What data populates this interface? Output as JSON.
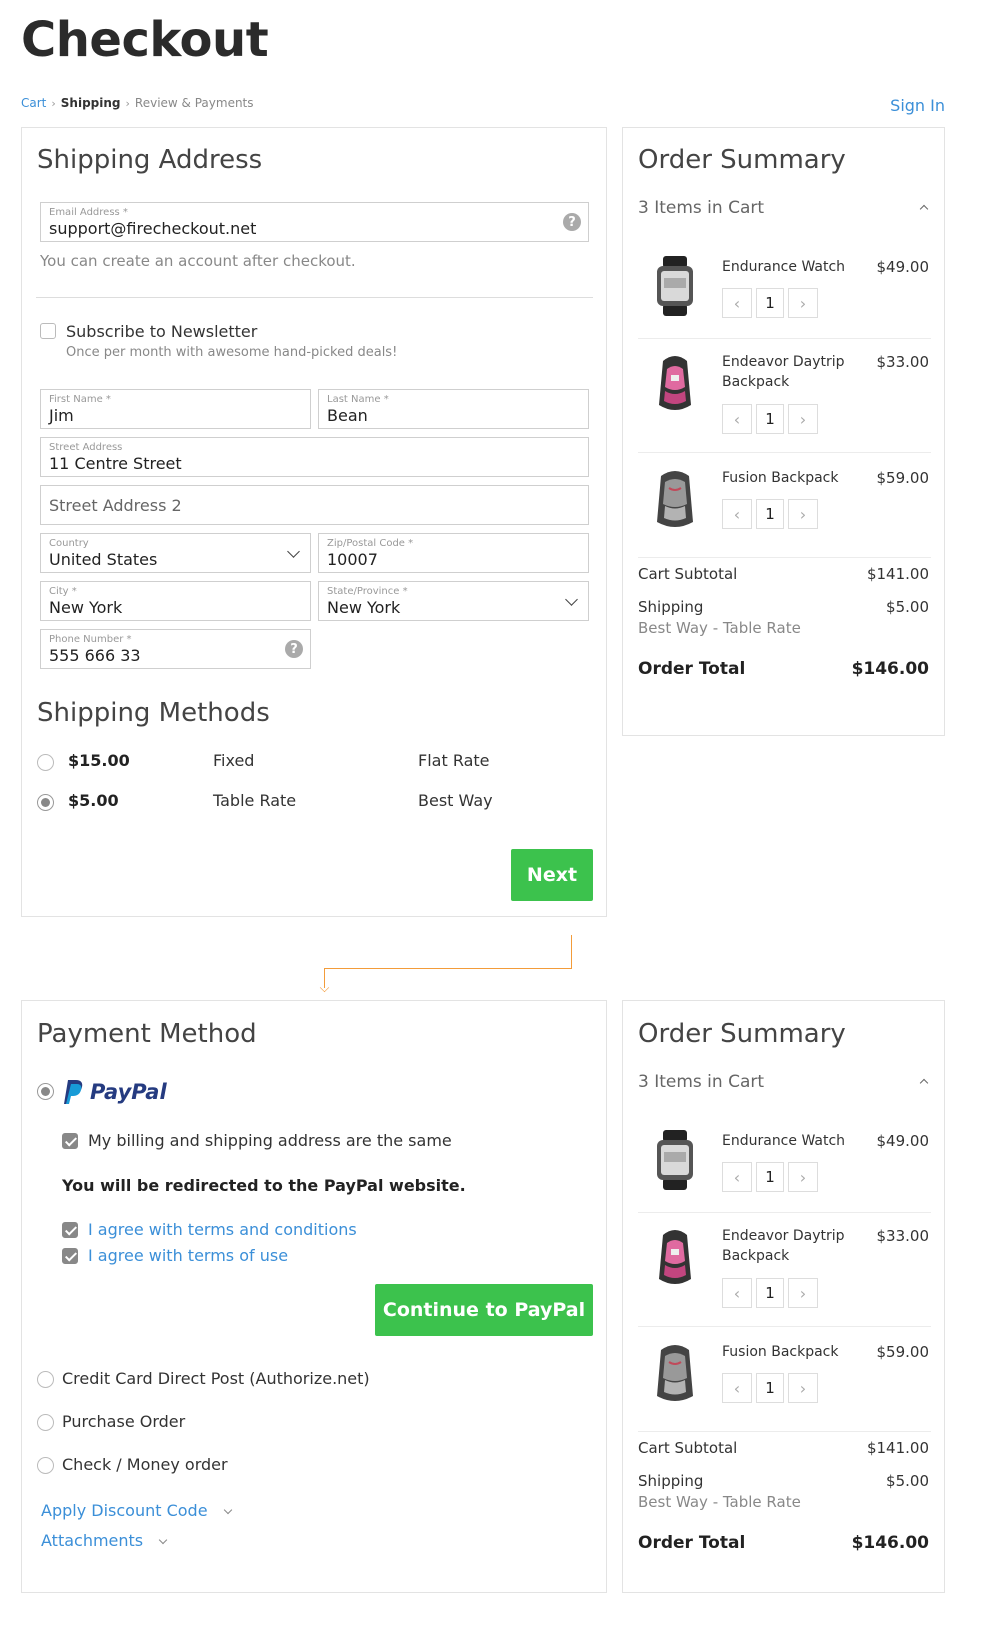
{
  "page": {
    "title": "Checkout",
    "sign_in": "Sign In"
  },
  "breadcrumb": [
    {
      "label": "Cart"
    },
    {
      "label": "Shipping"
    },
    {
      "label": "Review & Payments"
    }
  ],
  "shipping": {
    "title": "Shipping Address",
    "email": {
      "label": "Email Address *",
      "value": "support@firecheckout.net",
      "note": "You can create an account after checkout."
    },
    "newsletter": {
      "label": "Subscribe to Newsletter",
      "sub": "Once per month with awesome hand-picked deals!"
    },
    "first_name": {
      "label": "First Name *",
      "value": "Jim"
    },
    "last_name": {
      "label": "Last Name *",
      "value": "Bean"
    },
    "street": {
      "label": "Street Address",
      "value": "11 Centre Street"
    },
    "street2": {
      "placeholder": "Street Address 2"
    },
    "country": {
      "label": "Country",
      "value": "United States"
    },
    "zip": {
      "label": "Zip/Postal Code *",
      "value": "10007"
    },
    "city": {
      "label": "City *",
      "value": "New York"
    },
    "state": {
      "label": "State/Province *",
      "value": "New York"
    },
    "phone": {
      "label": "Phone Number *",
      "value": "555 666 33"
    },
    "methods_title": "Shipping Methods",
    "methods": [
      {
        "price": "$15.00",
        "method": "Fixed",
        "carrier": "Flat Rate",
        "selected": false
      },
      {
        "price": "$5.00",
        "method": "Table Rate",
        "carrier": "Best Way",
        "selected": true
      }
    ],
    "next": "Next"
  },
  "payment": {
    "title": "Payment Method",
    "paypal_logo": "PayPal",
    "billing_same": "My billing and shipping address are the same",
    "redirect_note": "You will be redirected to the PayPal website.",
    "agree_terms": "I agree with terms and conditions",
    "agree_use": "I agree with terms of use",
    "continue": "Continue to PayPal",
    "options": [
      "Credit Card Direct Post (Authorize.net)",
      "Purchase Order",
      "Check / Money order"
    ],
    "discount": "Apply Discount Code",
    "attachments": "Attachments"
  },
  "summary": {
    "title": "Order Summary",
    "items_count": "3 Items in Cart",
    "items": [
      {
        "name": "Endurance Watch",
        "name2": "",
        "price": "$49.00",
        "qty": "1",
        "image": "watch-image"
      },
      {
        "name": "Endeavor Daytrip",
        "name2": "Backpack",
        "price": "$33.00",
        "qty": "1",
        "image": "pink-backpack-image"
      },
      {
        "name": "Fusion Backpack",
        "name2": "",
        "price": "$59.00",
        "qty": "1",
        "image": "gray-backpack-image"
      }
    ],
    "subtotal_label": "Cart Subtotal",
    "subtotal": "$141.00",
    "shipping_label": "Shipping",
    "shipping_value": "$5.00",
    "shipping_method": "Best Way - Table Rate",
    "total_label": "Order Total",
    "total": "$146.00"
  },
  "colors": {
    "accent": "#3b8fd8",
    "button": "#3cc24d",
    "arrow": "#f39c3a"
  }
}
